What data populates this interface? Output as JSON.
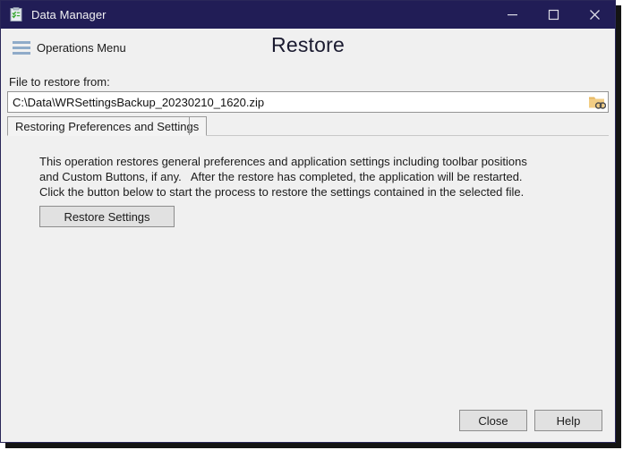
{
  "window": {
    "title": "Data Manager",
    "app_icon": "clipboard-check-icon",
    "controls": {
      "minimize": "minimize-icon",
      "maximize": "maximize-icon",
      "close": "close-icon"
    },
    "titlebar_color": "#211d56",
    "background_color": "#f0f0f0"
  },
  "menubar": {
    "menu_icon": "hamburger-icon",
    "menu_label": "Operations Menu"
  },
  "header": {
    "page_title": "Restore"
  },
  "file_section": {
    "label": "File to restore from:",
    "value": "C:\\Data\\WRSettingsBackup_20230210_1620.zip",
    "placeholder": "",
    "browse_icon": "folder-search-icon"
  },
  "tabs": [
    {
      "label": "Restoring Preferences and Settings",
      "selected": true
    }
  ],
  "panel": {
    "description": "This operation restores general preferences and application settings including toolbar positions and Custom Buttons, if any.   After the restore has completed, the application will be restarted.  Click the button below to start the process to restore the settings contained in the selected file.",
    "action_button": "Restore Settings"
  },
  "footer": {
    "close_label": "Close",
    "help_label": "Help"
  }
}
